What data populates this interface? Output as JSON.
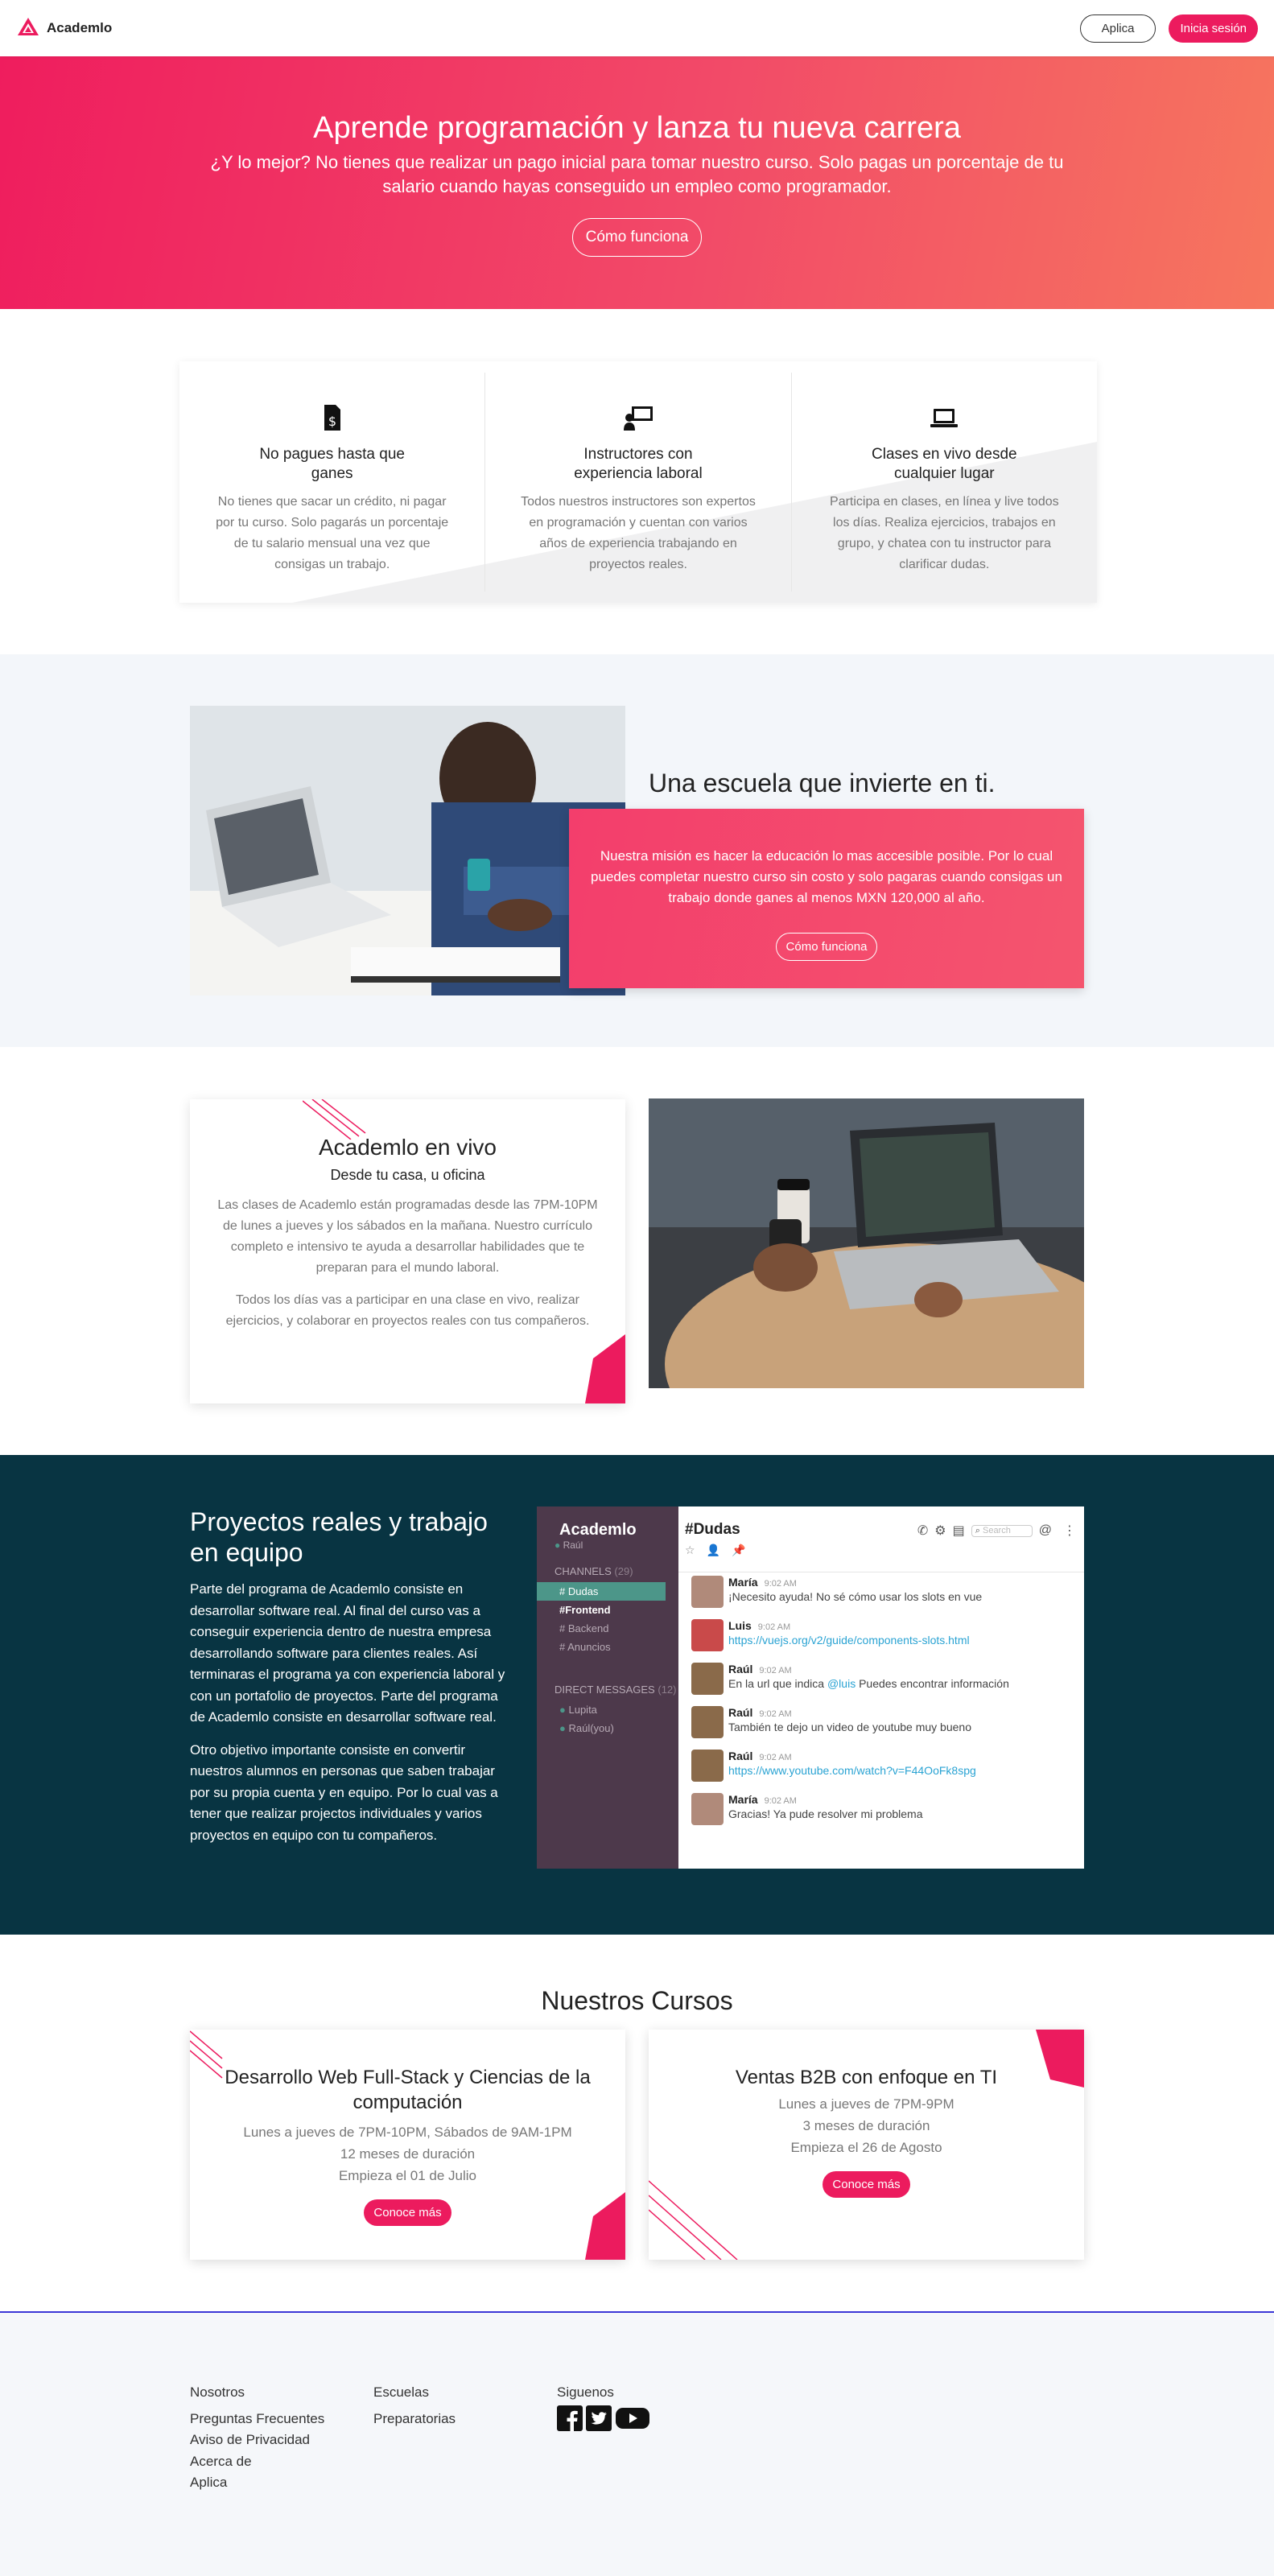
{
  "nav": {
    "brand": "Academlo",
    "apply_label": "Aplica",
    "login_label": "Inicia sesión"
  },
  "hero": {
    "title": "Aprende programación y lanza tu nueva carrera",
    "subtitle": "¿Y lo mejor? No tienes que realizar un pago inicial para tomar nuestro curso. Solo pagas un porcentaje de tu salario cuando hayas conseguido un empleo como programador.",
    "cta_label": "Cómo funciona"
  },
  "features": [
    {
      "icon": "document-dollar-icon",
      "title": "No pagues hasta que ganes",
      "text": "No tienes que sacar un crédito, ni pagar por tu curso. Solo pagarás un porcentaje de tu salario mensual una vez que consigas un trabajo."
    },
    {
      "icon": "instructor-board-icon",
      "title": "Instructores con experiencia laboral",
      "text": "Todos nuestros instructores son expertos en programación y cuentan con varios años de experiencia trabajando en proyectos reales."
    },
    {
      "icon": "laptop-icon",
      "title": "Clases en vivo desde cualquier lugar",
      "text": "Participa en clases, en línea y live todos los días. Realiza ejercicios, trabajos en grupo, y chatea con tu instructor para clarificar dudas."
    }
  ],
  "school": {
    "title": "Una escuela que invierte en ti.",
    "text": "Nuestra misión es hacer la educación lo mas accesible posible. Por lo cual puedes completar nuestro curso sin costo y solo pagaras cuando consigas un trabajo donde ganes al menos MXN 120,000 al año.",
    "cta_label": "Cómo funciona"
  },
  "live": {
    "title": "Academlo en vivo",
    "subtitle": "Desde tu casa, u oficina",
    "p1": "Las clases de Academlo están programadas desde las 7PM-10PM de lunes a jueves y los sábados en la mañana. Nuestro currículo completo e intensivo te ayuda a desarrollar habilidades que te preparan para el mundo laboral.",
    "p2": "Todos los días vas a participar en una clase en vivo, realizar ejercicios, y colaborar en proyectos reales con tus compañeros."
  },
  "projects": {
    "title": "Proyectos reales y trabajo en equipo",
    "p1": "Parte del programa de Academlo consiste en desarrollar software real. Al final del curso vas a conseguir experiencia dentro de nuestra empresa desarrollando software para clientes reales. Así terminaras el programa ya con experiencia laboral y con un portafolio de proyectos. Parte del programa de Academlo consiste en desarrollar software real.",
    "p2": "Otro objetivo importante consiste en convertir nuestros alumnos en personas que saben trabajar por su propia cuenta y en equipo. Por lo cual vas a tener que realizar projectos individuales y varios proyectos en equipo con tu compañeros."
  },
  "slack": {
    "team": "Academlo",
    "user": "Raúl",
    "channels_header": "CHANNELS",
    "channels_count": "(29)",
    "channels": [
      "# Dudas",
      "#Frontend",
      "# Backend",
      "# Anuncios"
    ],
    "dm_header": "DIRECT MESSAGES",
    "dm_count": "(12)",
    "dms": [
      "Lupita",
      "Raúl(you)"
    ],
    "channel_title": "#Dudas",
    "search_placeholder": "Search",
    "messages": [
      {
        "name": "María",
        "time": "9:02 AM",
        "text": "¡Necesito ayuda! No sé cómo usar los slots en vue",
        "color": "#b08a7a"
      },
      {
        "name": "Luis",
        "time": "9:02 AM",
        "text": "https://vuejs.org/v2/guide/components-slots.html",
        "link": true,
        "color": "#c94a4a"
      },
      {
        "name": "Raúl",
        "time": "9:02 AM",
        "pre": "En la url que indica ",
        "mention": "@luis",
        "post": " Puedes encontrar información",
        "color": "#8a6a4a"
      },
      {
        "name": "Raúl",
        "time": "9:02 AM",
        "text": "También te dejo un video de youtube muy bueno",
        "color": "#8a6a4a"
      },
      {
        "name": "Raúl",
        "time": "9:02 AM",
        "text": "https://www.youtube.com/watch?v=F44OoFk8spg",
        "link": true,
        "color": "#8a6a4a"
      },
      {
        "name": "María",
        "time": "9:02 AM",
        "text": "Gracias! Ya pude resolver mi problema",
        "color": "#b08a7a"
      }
    ]
  },
  "courses": {
    "title": "Nuestros Cursos",
    "items": [
      {
        "title": "Desarrollo Web Full-Stack y Ciencias de la computación",
        "schedule": "Lunes a jueves de 7PM-10PM, Sábados de 9AM-1PM",
        "duration": "12 meses de duración",
        "start": "Empieza el 01 de Julio",
        "cta": "Conoce más"
      },
      {
        "title": "Ventas B2B con enfoque en TI",
        "schedule": "Lunes a jueves de 7PM-9PM",
        "duration": "3 meses de duración",
        "start": "Empieza el 26 de Agosto",
        "cta": "Conoce más"
      }
    ]
  },
  "footer": {
    "col1": [
      "Nosotros",
      "Preguntas Frecuentes",
      "Aviso de Privacidad",
      "Acerca de",
      "Aplica"
    ],
    "col2": [
      "Escuelas",
      "Preparatorias"
    ],
    "follow_label": "Siguenos",
    "social": [
      "facebook-icon",
      "twitter-icon",
      "youtube-icon"
    ]
  },
  "colors": {
    "accent": "#ec1b5e",
    "dark_teal": "#083442",
    "slack_sidebar": "#4d394b"
  }
}
